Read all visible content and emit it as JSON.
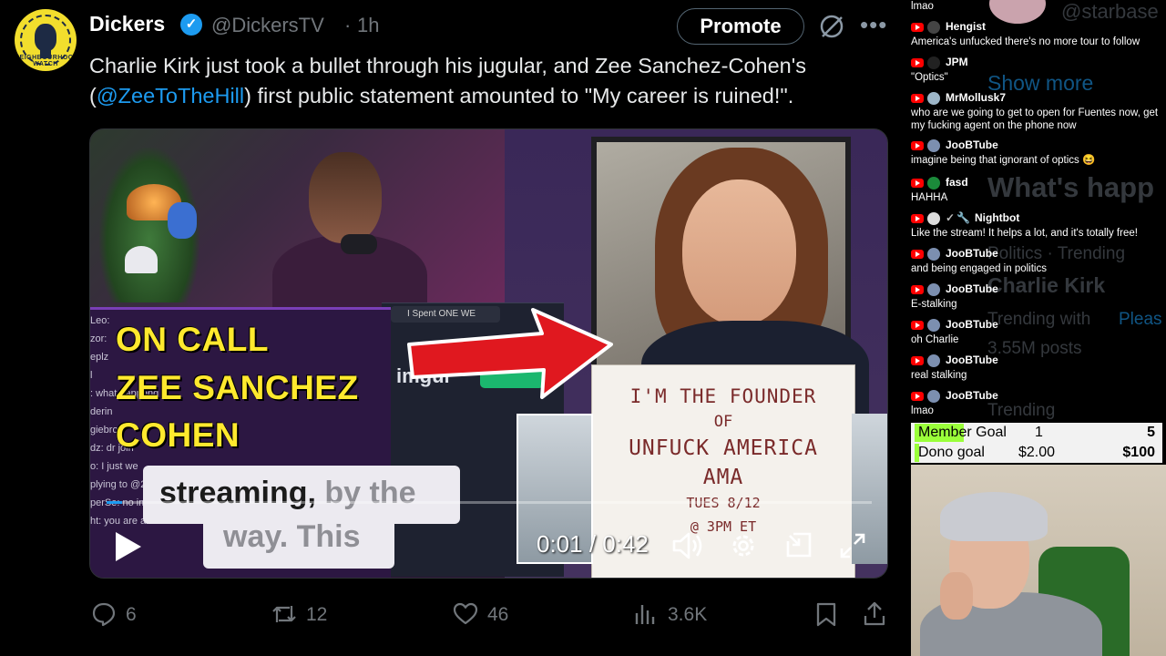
{
  "tweet": {
    "author_name": "Dickers",
    "handle": "@DickersTV",
    "separator": "·",
    "time": "1h",
    "avatar_label": "NEIGHBOURHOOD WATCH",
    "promote_label": "Promote",
    "text_before": "Charlie Kirk just took a bullet through his jugular, and Zee Sanchez-Cohen's (",
    "mention": "@ZeeToTheHill",
    "text_after": ") first public statement amounted to \"My career is ruined!\".",
    "stats": {
      "replies": "6",
      "reposts": "12",
      "likes": "46",
      "views": "3.6K"
    }
  },
  "video": {
    "overlay_title": [
      "ON CALL",
      "ZEE SANCHEZ",
      "COHEN"
    ],
    "caption_line1_dark": "streaming,",
    "caption_line1_grey": " by the",
    "caption_line2": "way. This",
    "browser_tab": "I Spent ONE WE",
    "imgur_label": "imgur",
    "sign_lines": [
      "I'M THE FOUNDER",
      "OF",
      "UNFUCK AMERICA",
      "AMA",
      "TUES 8/12",
      "@ 3PM ET"
    ],
    "chat_fragments": [
      "Leo:",
      "zor:",
      "eplz",
      "l ",
      ": what happend",
      "derin",
      "giebro:",
      "dz: dr join",
      "o: I just we",
      "plying to @2bt",
      "perSe: no im not so",
      "ht: you are an"
    ],
    "time_current": "0:01",
    "time_sep": " / ",
    "time_total": "0:42",
    "progress_fraction": 0.02
  },
  "chat": {
    "ghost_text": {
      "starbase": "@starbase",
      "show_more": "Show more",
      "whats_happening": "What's happ",
      "politics": "Politics · Trending",
      "charlie": "Charlie Kirk",
      "trending_with": "Trending with",
      "please": "Pleas",
      "posts": "3.55M posts",
      "trending": "Trending"
    },
    "messages": [
      {
        "user": "",
        "text": "lmao"
      },
      {
        "user": "Hengist",
        "text": "America's unfucked there's no more tour to follow"
      },
      {
        "user": "JPM",
        "text": "\"Optics\""
      },
      {
        "user": "MrMollusk7",
        "text": "who are we going to get to open for Fuentes now, get my fucking agent on the phone now"
      },
      {
        "user": "JooBTube",
        "text": "imagine being that ignorant of optics 😆"
      },
      {
        "user": "fasd",
        "text": "HAHHA"
      },
      {
        "user": "Nightbot",
        "text": "Like the stream! It helps a lot, and it's totally free!"
      },
      {
        "user": "JooBTube",
        "text": "and being engaged in politics"
      },
      {
        "user": "JooBTube",
        "text": "E-stalking"
      },
      {
        "user": "JooBTube",
        "text": "oh Charlie"
      },
      {
        "user": "JooBTube",
        "text": "real stalking"
      },
      {
        "user": "JooBTube",
        "text": "lmao"
      }
    ],
    "goals": {
      "member_label": "Member Goal",
      "member_current": "1",
      "member_target": "5",
      "member_fraction": 0.2,
      "dono_label": "Dono goal",
      "dono_current": "$2.00",
      "dono_target": "$100",
      "dono_fraction": 0.02
    }
  }
}
